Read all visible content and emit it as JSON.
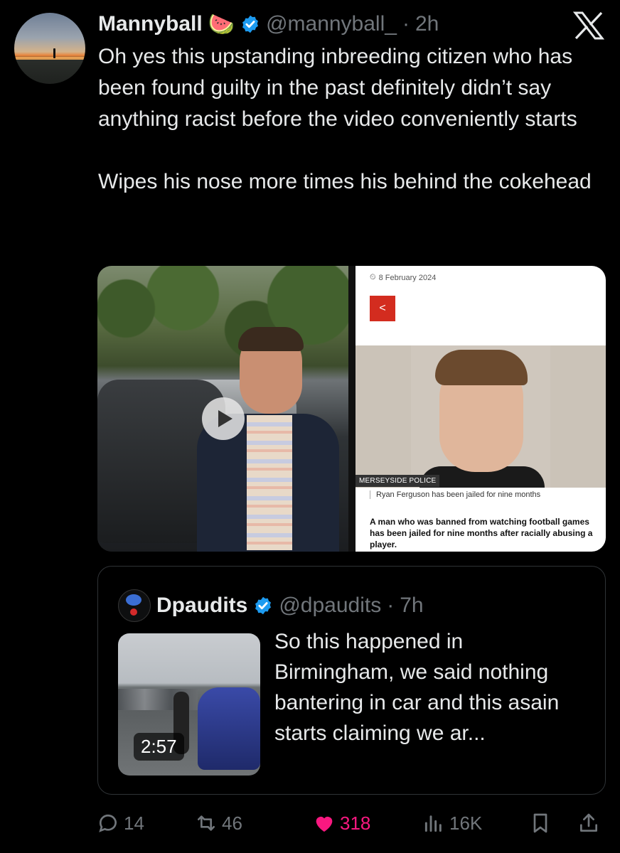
{
  "tweet": {
    "author_name": "Mannyball",
    "author_emoji": "🍉",
    "author_handle": "@mannyball_",
    "separator": "·",
    "timestamp": "2h",
    "text_p1": "Oh yes this upstanding inbreeding citizen who has been found guilty in the past definitely didn’t say anything racist before the video conveniently starts",
    "text_p2": "Wipes his nose more times his behind the cokehead"
  },
  "media": {
    "left_kind": "video",
    "article": {
      "date": "8 February 2024",
      "photo_credit": "MERSEYSIDE POLICE",
      "caption": "Ryan Ferguson has been jailed for nine months",
      "summary": "A man who was banned from watching football games has been jailed for nine months after racially abusing a player."
    }
  },
  "quote": {
    "author_name": "Dpaudits",
    "author_handle": "@dpaudits",
    "separator": "·",
    "timestamp": "7h",
    "video_duration": "2:57",
    "text": "So this happened in Birmingham, we said nothing bantering in car and this asain starts claiming we ar..."
  },
  "actions": {
    "replies": "14",
    "reposts": "46",
    "likes": "318",
    "views": "16K"
  },
  "icons": [
    "x-logo-icon",
    "verified-badge-icon",
    "play-icon",
    "share-icon",
    "reply-icon",
    "repost-icon",
    "like-icon",
    "views-icon",
    "bookmark-icon",
    "share-up-icon"
  ],
  "colors": {
    "background": "#000000",
    "text": "#e7e9ea",
    "muted": "#71767b",
    "verified": "#1d9bf0",
    "like": "#f91880",
    "border": "#2f3336"
  }
}
